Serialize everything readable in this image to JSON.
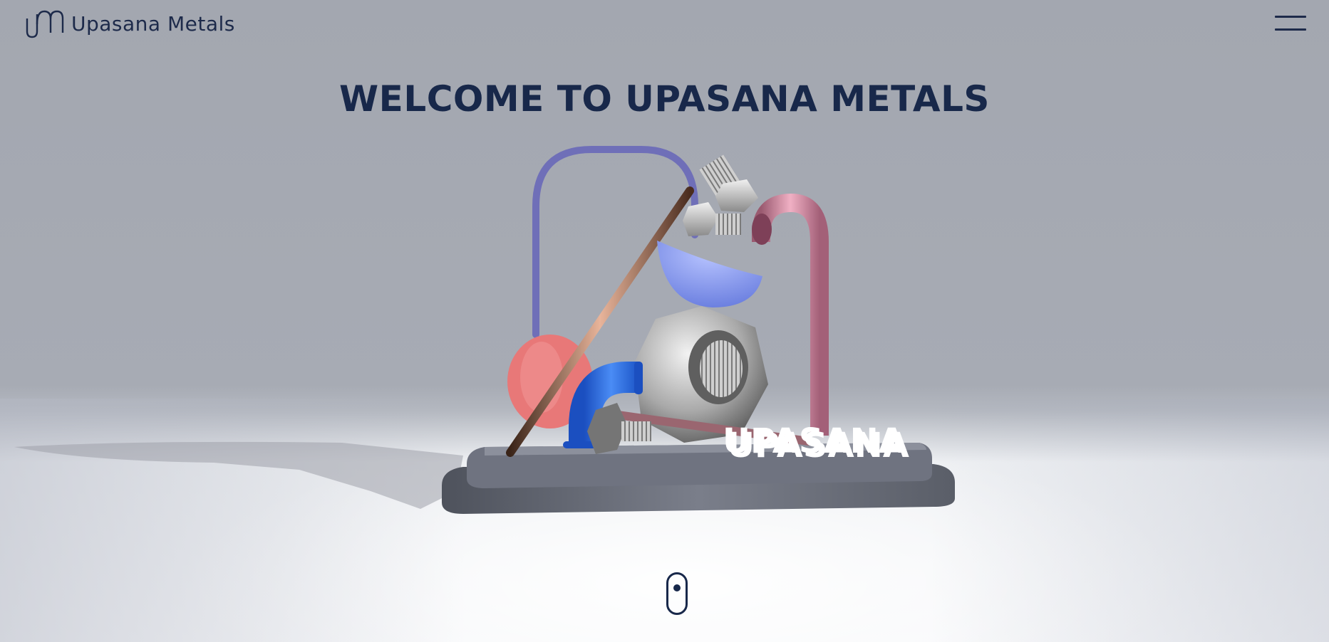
{
  "header": {
    "brand_name": "Upasana Metals",
    "logo_icon": "um-monogram-icon",
    "menu_icon": "hamburger-menu-icon"
  },
  "hero": {
    "title": "WELCOME TO UPASANA METALS",
    "scene_label": "UPASANA"
  },
  "scroll_indicator_icon": "mouse-scroll-icon",
  "colors": {
    "text_primary": "#18284a",
    "background_wall": "#a5a9b2",
    "floor": "#f4f5f7",
    "pipe_purple": "#6f6fb8",
    "pipe_pink": "#d08ca2",
    "elbow_blue": "#2e6fe0",
    "bowl_periwinkle": "#8fa2f0",
    "disc_coral": "#e87878",
    "rod_copper": "#7a5040",
    "base_gray": "#6f7380"
  }
}
